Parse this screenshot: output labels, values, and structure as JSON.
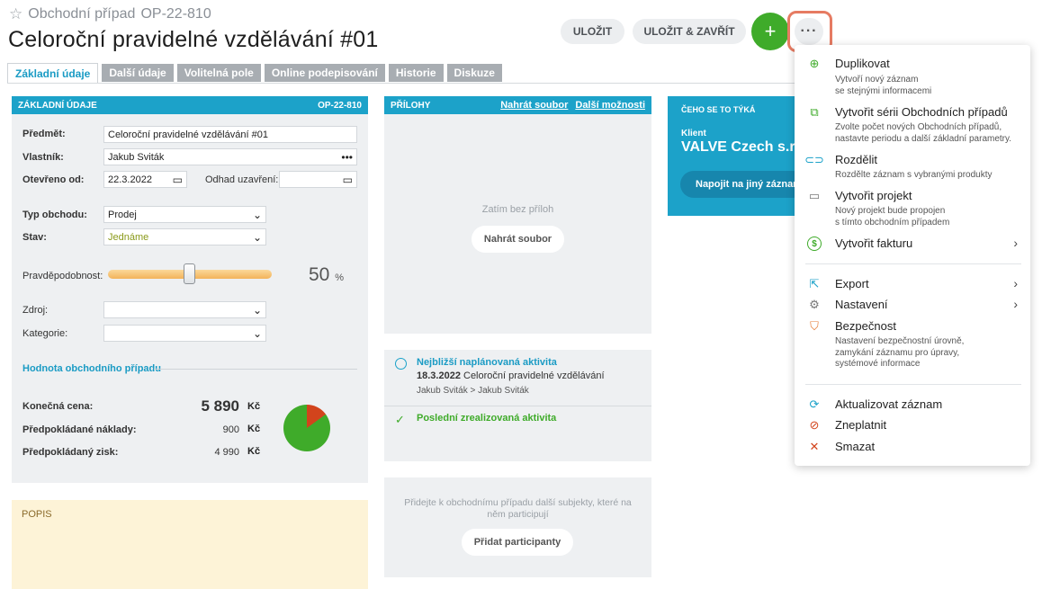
{
  "header": {
    "breadcrumb_type": "Obchodní případ",
    "breadcrumb_id": "OP-22-810",
    "title": "Celoroční pravidelné vzdělávání #01",
    "save_label": "ULOŽIT",
    "save_close_label": "ULOŽIT & ZAVŘÍT",
    "plus_label": "+",
    "more_label": "···"
  },
  "tabs": [
    "Základní údaje",
    "Další údaje",
    "Volitelná pole",
    "Online podepisování",
    "Historie",
    "Diskuze"
  ],
  "basic": {
    "heading": "ZÁKLADNÍ ÚDAJE",
    "code": "OP-22-810",
    "subject_label": "Předmět:",
    "subject_value": "Celoroční pravidelné vzdělávání #01",
    "owner_label": "Vlastník:",
    "owner_value": "Jakub Sviták",
    "opened_label": "Otevřeno od:",
    "opened_value": "22.3.2022",
    "close_label": "Odhad uzavření:",
    "close_value": "",
    "type_label": "Typ obchodu:",
    "type_value": "Prodej",
    "state_label": "Stav:",
    "state_value": "Jednáme",
    "prob_label": "Pravděpodobnost:",
    "prob_value": "50",
    "prob_unit": "%",
    "prob_fraction": 0.5,
    "source_label": "Zdroj:",
    "category_label": "Kategorie:",
    "value_section": "Hodnota obchodního případu",
    "final_label": "Konečná cena:",
    "final_value": "5 890",
    "final_cur": "Kč",
    "costs_label": "Předpokládané náklady:",
    "costs_value": "900",
    "costs_cur": "Kč",
    "profit_label": "Předpokládaný zisk:",
    "profit_value": "4 990",
    "profit_cur": "Kč",
    "pie_costs_share": 0.15
  },
  "popis": {
    "label": "POPIS"
  },
  "attachments": {
    "heading": "PŘÍLOHY",
    "upload_link": "Nahrát soubor",
    "more_link": "Další možnosti",
    "empty_text": "Zatím bez příloh",
    "upload_button": "Nahrát soubor"
  },
  "activities": {
    "next_title": "Nejbližší naplánovaná aktivita",
    "next_date": "18.3.2022",
    "next_name": "Celoroční pravidelné vzdělávání",
    "next_people": "Jakub Sviták > Jakub Sviták",
    "last_title": "Poslední zrealizovaná aktivita"
  },
  "participants": {
    "text_line1": "Přidejte k obchodnímu případu další subjekty, které na",
    "text_line2": "něm participují",
    "button": "Přidat participanty"
  },
  "info": {
    "heading": "ČEHO SE TO TÝKÁ",
    "client_label": "Klient",
    "client_value": "VALVE Czech s.r.o.",
    "connect_button": "Napojit na jiný záznam"
  },
  "menu": {
    "items": [
      {
        "label": "Duplikovat",
        "desc": [
          "Vytvoří nový záznam",
          "se stejnými informacemi"
        ],
        "icon": "duplicate-icon"
      },
      {
        "label": "Vytvořit sérii Obchodních případů",
        "desc": [
          "Zvolte počet nových Obchodních případů,",
          "nastavte periodu a další základní parametry."
        ],
        "icon": "series-icon"
      },
      {
        "label": "Rozdělit",
        "desc": [
          "Rozdělte záznam s vybranými produkty"
        ],
        "icon": "split-icon"
      },
      {
        "label": "Vytvořit projekt",
        "desc": [
          "Nový projekt bude propojen",
          "s tímto obchodním případem"
        ],
        "icon": "folder-icon"
      },
      {
        "label": "Vytvořit fakturu",
        "desc": [],
        "icon": "invoice-icon"
      },
      {
        "label": "Export",
        "desc": [],
        "icon": "export-icon"
      },
      {
        "label": "Nastavení",
        "desc": [],
        "icon": "gear-icon"
      },
      {
        "label": "Bezpečnost",
        "desc": [
          "Nastavení bezpečnostní úrovně,",
          "zamykání záznamu pro úpravy,",
          "systémové informace"
        ],
        "icon": "shield-icon"
      },
      {
        "label": "Aktualizovat záznam",
        "desc": [],
        "icon": "refresh-icon"
      },
      {
        "label": "Zneplatnit",
        "desc": [],
        "icon": "invalidate-icon"
      },
      {
        "label": "Smazat",
        "desc": [],
        "icon": "delete-icon"
      }
    ]
  },
  "colors": {
    "accent": "#1ca2c9",
    "green": "#3fab2a",
    "orange": "#e67b62",
    "state_text": "#8a9a1a"
  }
}
